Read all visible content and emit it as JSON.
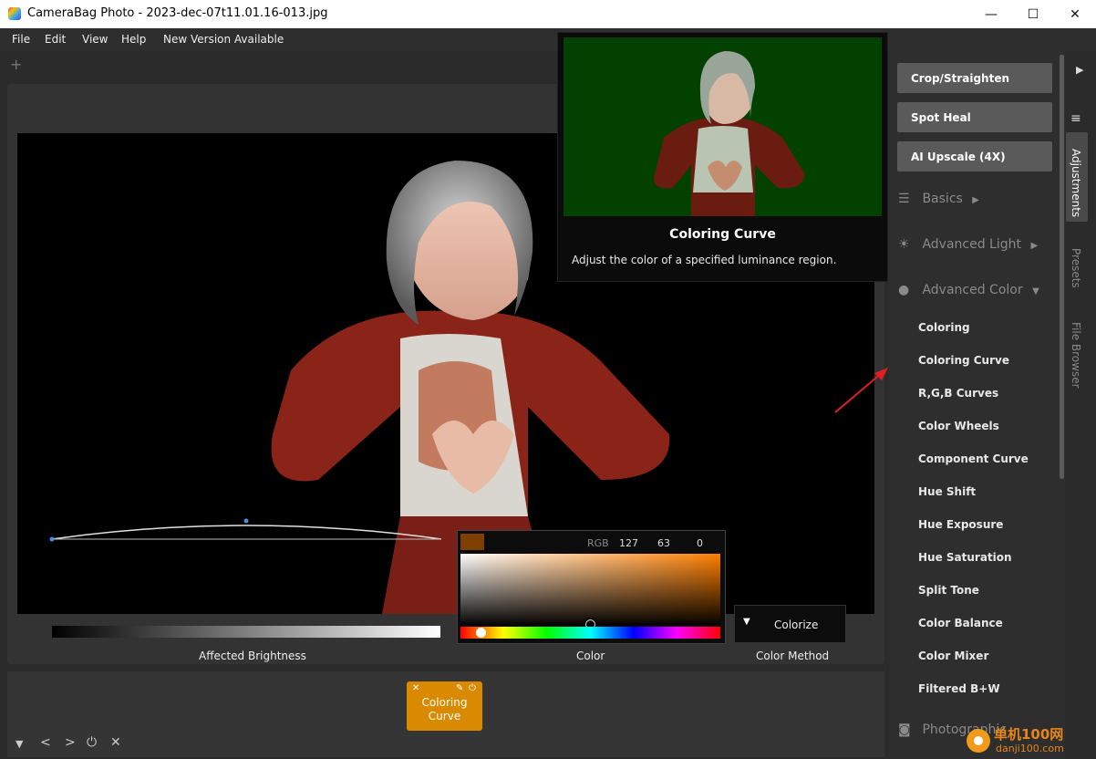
{
  "window": {
    "title": "CameraBag Photo - 2023-dec-07t11.01.16-013.jpg",
    "minimize": "—",
    "maximize": "☐",
    "close": "✕"
  },
  "menu": [
    "File",
    "Edit",
    "View",
    "Help",
    "New Version Available"
  ],
  "tab_add": "+",
  "tooltip": {
    "title": "Coloring Curve",
    "description": "Adjust the color of a specified luminance region."
  },
  "controls": {
    "brightness_label": "Affected Brightness",
    "color_label": "Color",
    "method_label": "Color Method",
    "method_value": "Colorize",
    "rgb_label": "RGB",
    "r": "127",
    "g": "63",
    "b": "0",
    "color_hex": "#7f3f00"
  },
  "adjustment_chip": {
    "line1": "Coloring",
    "line2": "Curve",
    "color": "#d98a00"
  },
  "bottom_controls": [
    "▼",
    "<",
    ">",
    "⏻",
    "✕"
  ],
  "right_panel": {
    "tools": [
      "Crop/Straighten",
      "Spot Heal",
      "AI Upscale (4X)"
    ],
    "sections": {
      "basics": "Basics",
      "advanced_light": "Advanced Light",
      "advanced_color": "Advanced Color",
      "photographic": "Photographic"
    },
    "advanced_color_items": [
      "Coloring",
      "Coloring Curve",
      "R,G,B Curves",
      "Color Wheels",
      "Component Curve",
      "Hue Shift",
      "Hue Exposure",
      "Hue Saturation",
      "Split Tone",
      "Color Balance",
      "Color Mixer",
      "Filtered B+W"
    ]
  },
  "side_tabs": [
    "Adjustments",
    "Presets",
    "File Browser"
  ],
  "watermark": {
    "text_cn": "单机100网",
    "text_url": "danji100.com"
  }
}
